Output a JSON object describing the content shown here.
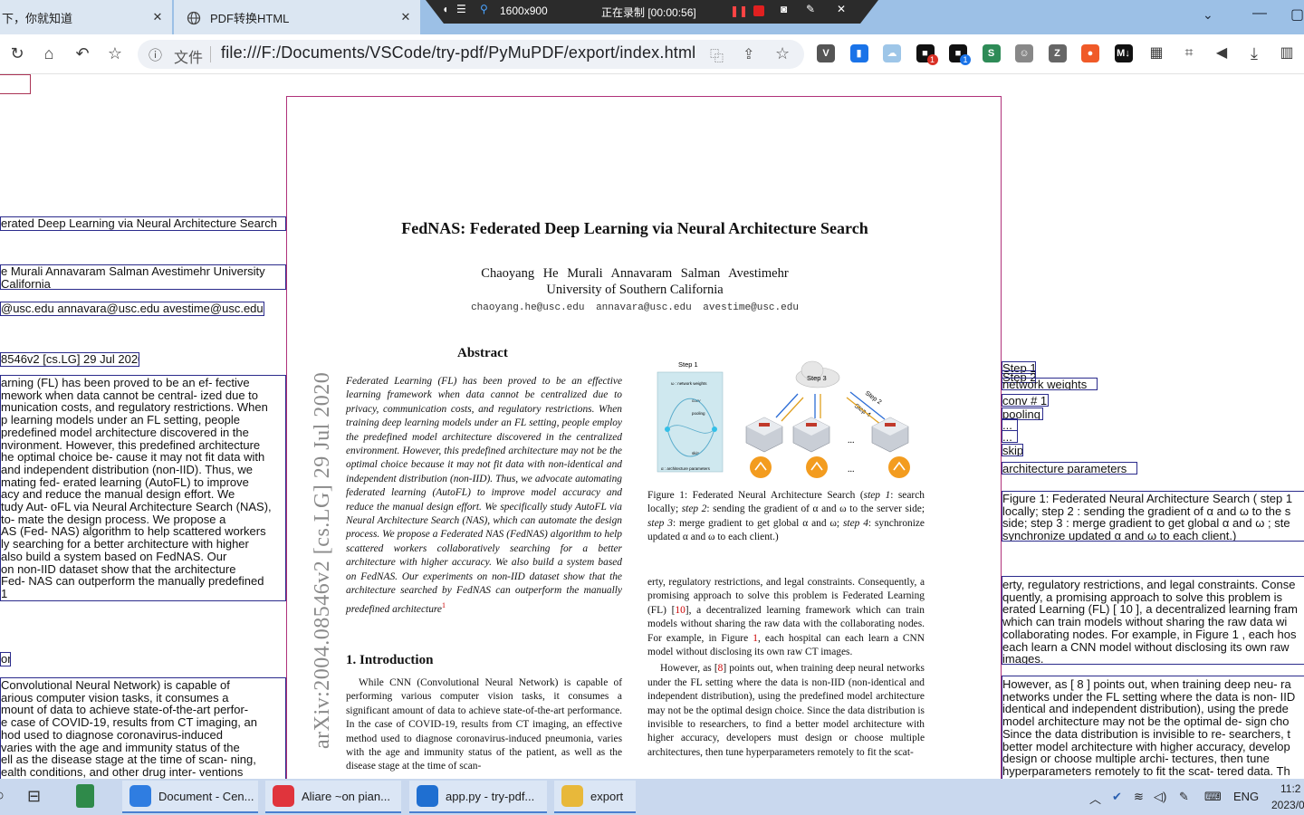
{
  "browser": {
    "tabs": [
      {
        "title": "下，你就知道",
        "active": false
      },
      {
        "title": "PDF转换HTML",
        "active": false
      }
    ],
    "url_scheme": "文件",
    "url": "file:///F:/Documents/VSCode/try-pdf/PyMuPDF/export/index.html"
  },
  "recorder": {
    "resolution": "1600x900",
    "status": "正在录制 [00:00:56]"
  },
  "extensions": [
    {
      "name": "v-icon",
      "color": "#555555",
      "glyph": "V"
    },
    {
      "name": "bookmark-icon",
      "color": "#1a73e8",
      "glyph": "▮"
    },
    {
      "name": "cloud-icon",
      "color": "#9ec6e8",
      "glyph": "☁"
    },
    {
      "name": "ext-1-icon",
      "color": "#111111",
      "glyph": "■",
      "badge": "1",
      "badge_color": "red"
    },
    {
      "name": "ext-2-icon",
      "color": "#111111",
      "glyph": "■",
      "badge": "1",
      "badge_color": "blue"
    },
    {
      "name": "s-icon",
      "color": "#2e8b57",
      "glyph": "S"
    },
    {
      "name": "cat-icon",
      "color": "#888888",
      "glyph": "☺"
    },
    {
      "name": "z-icon",
      "color": "#666666",
      "glyph": "Z"
    },
    {
      "name": "orange-icon",
      "color": "#f05a28",
      "glyph": "●"
    },
    {
      "name": "md-icon",
      "color": "#111111",
      "glyph": "M↓"
    }
  ],
  "left_column": {
    "title": "erated Deep Learning via Neural Architecture Search",
    "authors": [
      "e Murali Annavaram Salman Avestimehr University",
      "California"
    ],
    "emails": "@usc.edu annavara@usc.edu avestime@usc.edu",
    "arxiv": "8546v2 [cs.LG] 29 Jul 2020",
    "abstract_lines": [
      "arning (FL) has been proved to be an ef- fective",
      "mework when data cannot be central- ized due to",
      "munication costs, and regulatory restrictions. When",
      "p learning models under an FL setting, people",
      "predefined model architecture discovered in the",
      "nvironment. However, this predefined architecture",
      "he optimal choice be- cause it may not fit data with",
      " and independent distribution (non-IID). Thus, we",
      "mating fed- erated learning (AutoFL) to improve",
      "acy and reduce the manual design effort. We",
      "tudy Aut- oFL via Neural Architecture Search (NAS),",
      "to- mate the design process. We propose a",
      "AS (Fed- NAS) algorithm to help scattered workers",
      "ly searching for a better architecture with higher",
      " also build a system based on FedNAS. Our",
      "on non-IID dataset show that the architecture",
      "Fed- NAS can outperform the manually predefined",
      "1"
    ],
    "intro_heading": "on",
    "intro_lines": [
      "Convolutional Neural Network) is capable of",
      "arious computer vision tasks, it consumes a",
      "mount of data to achieve state-of-the-art perfor-",
      "e case of COVID-19, results from CT imaging, an",
      "hod used to diagnose coronavirus-induced",
      "varies with the age and immunity status of the",
      "ell as the disease stage at the time of scan- ning,",
      "ealth conditions, and other drug inter- ventions"
    ]
  },
  "right_column": {
    "fig_labels": [
      "Step 1",
      "Step 2",
      "network weights",
      "conv # 1",
      "pooling",
      "...",
      "skip",
      "architecture parameters"
    ],
    "caption_lines": [
      "Figure 1: Federated Neural Architecture Search ( step 1",
      "locally; step 2 : sending the gradient of α and ω to the s",
      "side; step 3 : merge gradient to get global α and ω ; ste",
      "synchronize updated α and ω to each client.)"
    ],
    "para1_lines": [
      "erty, regulatory restrictions, and legal constraints. Conse",
      "quently, a promising approach to solve this problem is",
      "erated Learning (FL) [ 10 ], a decentralized learning fram",
      "which can train models without sharing the raw data wi",
      "collaborating nodes. For example, in Figure 1 , each hos",
      "each learn a CNN model without disclosing its own raw",
      "images."
    ],
    "para2_lines": [
      "However, as [ 8 ] points out, when training deep neu- ra",
      "networks under the FL setting where the data is non- IID",
      "identical and independent distribution), using the prede",
      "model architecture may not be the optimal de- sign cho",
      "Since the data distribution is invisible to re- searchers, t",
      "better model architecture with higher accuracy, develop",
      "design or choose multiple archi- tectures, then tune",
      "hyperparameters remotely to fit the scat- tered data. Th"
    ]
  },
  "paper": {
    "title": "FedNAS: Federated Deep Learning via Neural Architecture Search",
    "authors": "Chaoyang He   Murali Annavaram   Salman Avestimehr",
    "affiliation": "University of Southern California",
    "emails": "chaoyang.he@usc.edu  annavara@usc.edu  avestime@usc.edu",
    "arxiv_id": "arXiv:2004.08546v2  [cs.LG]  29 Jul 2020",
    "abstract_heading": "Abstract",
    "abstract": "Federated Learning (FL) has been proved to be an effective learning framework when data cannot be centralized due to privacy, communication costs, and regulatory restrictions. When training deep learning models under an FL setting, people employ the predefined model architecture discovered in the centralized environment. However, this predefined architecture may not be the optimal choice because it may not fit data with non-identical and independent distribution (non-IID). Thus, we advocate automating federated learning (AutoFL) to improve model accuracy and reduce the manual design effort. We specifically study AutoFL via Neural Architecture Search (NAS), which can automate the design process. We propose a Federated NAS (FedNAS) algorithm to help scattered workers collaboratively searching for a better architecture with higher accuracy. We also build a system based on FedNAS. Our experiments on non-IID dataset show that the architecture searched by FedNAS can outperform the manually predefined architecture",
    "abstract_footnote": "1",
    "intro_heading": "1. Introduction",
    "intro": "While CNN (Convolutional Neural Network) is capable of performing various computer vision tasks, it consumes a significant amount of data to achieve state-of-the-art performance. In the case of COVID-19, results from CT imaging, an effective method used to diagnose coronavirus-induced pneumonia, varies with the age and immunity status of the patient, as well as the disease stage at the time of scan-",
    "figure": {
      "step1": "Step 1",
      "step2": "Step 2",
      "step3": "Step 3",
      "step4": "Step 4",
      "network_weights": "ω : network weights",
      "conv": "conv",
      "pooling": "pooling",
      "skip": "skip",
      "arch_params": "α : architecture parameters",
      "dots": "..."
    },
    "fig_caption_label": "Figure 1:",
    "fig_caption_main": "Federated Neural Architecture Search (",
    "fig_caption_s1": "step 1",
    "fig_caption_a": ": search locally;",
    "fig_caption_s2": "step 2",
    "fig_caption_b": ": sending the gradient of α and ω to the server side;",
    "fig_caption_s3": "step 3",
    "fig_caption_c": ": merge gradient to get global α and ω;",
    "fig_caption_s4": "step 4",
    "fig_caption_d": ": synchronize updated α and ω to each client.)",
    "para1_a": "erty, regulatory restrictions, and legal constraints. Consequently, a promising approach to solve this problem is Federated Learning (FL) [",
    "para1_ref": "10",
    "para1_b": "], a decentralized learning framework which can train models without sharing the raw data with the collaborating nodes. For example, in Figure",
    "para1_fig": "1",
    "para1_c": ", each hospital can each learn a CNN model without disclosing its own raw CT images.",
    "para2_a": "However, as [",
    "para2_ref": "8",
    "para2_b": "] points out, when training deep neural networks under the FL setting where the data is non-IID (non-identical and independent distribution), using the predefined model architecture may not be the optimal design choice. Since the data distribution is invisible to researchers, to find a better model architecture with higher accuracy, developers must design or choose multiple architectures, then tune hyperparameters remotely to fit the scat-"
  },
  "taskbar": {
    "apps": [
      {
        "label": "Document - Cen...",
        "color": "#2f7de1"
      },
      {
        "label": "Aliare ~on pian...",
        "color": "#e0343c"
      },
      {
        "label": "app.py - try-pdf...",
        "color": "#1f6fd1"
      },
      {
        "label": "export",
        "color": "#e8b83a"
      }
    ],
    "lang": "ENG",
    "time": "11:2",
    "date": "2023/0"
  }
}
